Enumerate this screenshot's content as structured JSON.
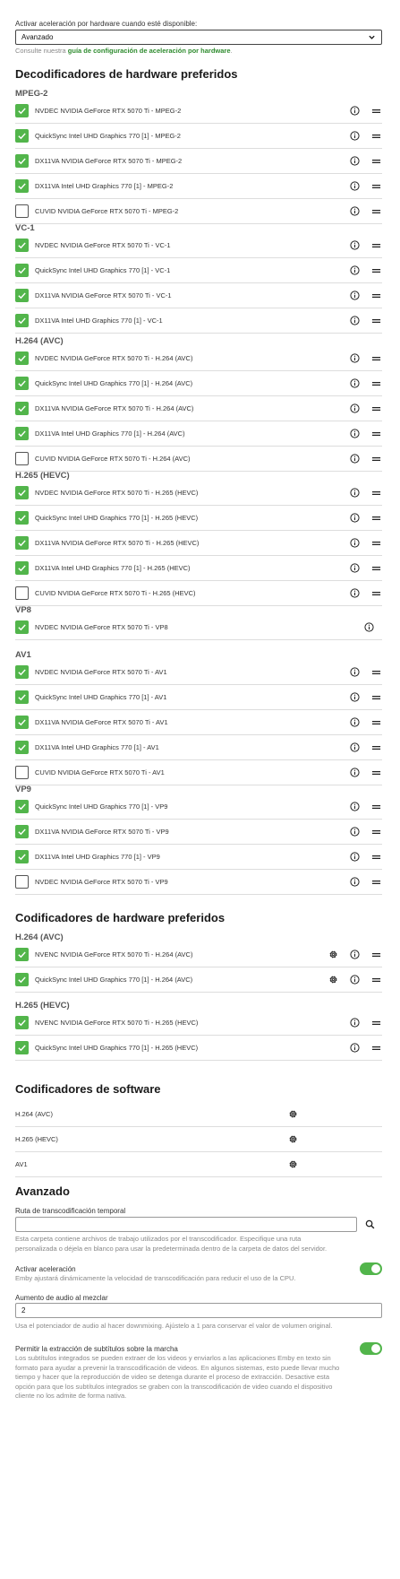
{
  "hw_accel": {
    "label": "Activar aceleración por hardware cuando esté disponible:",
    "value": "Avanzado",
    "help_prefix": "Consulte nuestra ",
    "help_link": "guía de configuración de aceleración por hardware",
    "help_suffix": "."
  },
  "decoders": {
    "title": "Decodificadores de hardware preferidos",
    "groups": [
      {
        "name": "MPEG-2",
        "items": [
          {
            "label": "NVDEC NVIDIA GeForce RTX 5070 Ti - MPEG-2",
            "checked": true
          },
          {
            "label": "QuickSync Intel UHD Graphics 770 [1] - MPEG-2",
            "checked": true
          },
          {
            "label": "DX11VA NVIDIA GeForce RTX 5070 Ti - MPEG-2",
            "checked": true
          },
          {
            "label": "DX11VA Intel UHD Graphics 770 [1] - MPEG-2",
            "checked": true
          },
          {
            "label": "CUVID NVIDIA GeForce RTX 5070 Ti - MPEG-2",
            "checked": false
          }
        ]
      },
      {
        "name": "VC-1",
        "items": [
          {
            "label": "NVDEC NVIDIA GeForce RTX 5070 Ti - VC-1",
            "checked": true
          },
          {
            "label": "QuickSync Intel UHD Graphics 770 [1] - VC-1",
            "checked": true
          },
          {
            "label": "DX11VA NVIDIA GeForce RTX 5070 Ti - VC-1",
            "checked": true
          },
          {
            "label": "DX11VA Intel UHD Graphics 770 [1] - VC-1",
            "checked": true
          }
        ]
      },
      {
        "name": "H.264 (AVC)",
        "items": [
          {
            "label": "NVDEC NVIDIA GeForce RTX 5070 Ti - H.264 (AVC)",
            "checked": true
          },
          {
            "label": "QuickSync Intel UHD Graphics 770 [1] - H.264 (AVC)",
            "checked": true
          },
          {
            "label": "DX11VA NVIDIA GeForce RTX 5070 Ti - H.264 (AVC)",
            "checked": true
          },
          {
            "label": "DX11VA Intel UHD Graphics 770 [1] - H.264 (AVC)",
            "checked": true
          },
          {
            "label": "CUVID NVIDIA GeForce RTX 5070 Ti - H.264 (AVC)",
            "checked": false
          }
        ]
      },
      {
        "name": "H.265 (HEVC)",
        "items": [
          {
            "label": "NVDEC NVIDIA GeForce RTX 5070 Ti - H.265 (HEVC)",
            "checked": true
          },
          {
            "label": "QuickSync Intel UHD Graphics 770 [1] - H.265 (HEVC)",
            "checked": true
          },
          {
            "label": "DX11VA NVIDIA GeForce RTX 5070 Ti - H.265 (HEVC)",
            "checked": true
          },
          {
            "label": "DX11VA Intel UHD Graphics 770 [1] - H.265 (HEVC)",
            "checked": true
          },
          {
            "label": "CUVID NVIDIA GeForce RTX 5070 Ti - H.265 (HEVC)",
            "checked": false
          }
        ]
      },
      {
        "name": "VP8",
        "single": true,
        "items": [
          {
            "label": "NVDEC NVIDIA GeForce RTX 5070 Ti - VP8",
            "checked": true
          }
        ]
      },
      {
        "name": "AV1",
        "items": [
          {
            "label": "NVDEC NVIDIA GeForce RTX 5070 Ti - AV1",
            "checked": true
          },
          {
            "label": "QuickSync Intel UHD Graphics 770 [1] - AV1",
            "checked": true
          },
          {
            "label": "DX11VA NVIDIA GeForce RTX 5070 Ti - AV1",
            "checked": true
          },
          {
            "label": "DX11VA Intel UHD Graphics 770 [1] - AV1",
            "checked": true
          },
          {
            "label": "CUVID NVIDIA GeForce RTX 5070 Ti - AV1",
            "checked": false
          }
        ]
      },
      {
        "name": "VP9",
        "items": [
          {
            "label": "QuickSync Intel UHD Graphics 770 [1] - VP9",
            "checked": true
          },
          {
            "label": "DX11VA NVIDIA GeForce RTX 5070 Ti - VP9",
            "checked": true
          },
          {
            "label": "DX11VA Intel UHD Graphics 770 [1] - VP9",
            "checked": true
          },
          {
            "label": "NVDEC NVIDIA GeForce RTX 5070 Ti - VP9",
            "checked": false
          }
        ]
      }
    ]
  },
  "encoders": {
    "title": "Codificadores de hardware preferidos",
    "groups": [
      {
        "name": "H.264 (AVC)",
        "items": [
          {
            "label": "NVENC NVIDIA GeForce RTX 5070 Ti - H.264 (AVC)",
            "checked": true,
            "gear": true
          },
          {
            "label": "QuickSync Intel UHD Graphics 770 [1] - H.264 (AVC)",
            "checked": true,
            "gear": true
          }
        ]
      },
      {
        "name": "H.265 (HEVC)",
        "items": [
          {
            "label": "NVENC NVIDIA GeForce RTX 5070 Ti - H.265 (HEVC)",
            "checked": true
          },
          {
            "label": "QuickSync Intel UHD Graphics 770 [1] - H.265 (HEVC)",
            "checked": true
          }
        ]
      }
    ]
  },
  "software": {
    "title": "Codificadores de software",
    "items": [
      "H.264 (AVC)",
      "H.265 (HEVC)",
      "AV1"
    ]
  },
  "advanced": {
    "title": "Avanzado",
    "temp_path_label": "Ruta de transcodificación temporal",
    "temp_path_value": "",
    "temp_path_help": "Esta carpeta contiene archivos de trabajo utilizados por el transcodificador. Especifique una ruta personalizada o déjela en blanco para usar la predeterminada dentro de la carpeta de datos del servidor.",
    "throttle_label": "Activar aceleración",
    "throttle_help": "Emby ajustará dinámicamente la velocidad de transcodificación para reducir el uso de la CPU.",
    "throttle_on": true,
    "boost_label": "Aumento de audio al mezclar",
    "boost_value": "2",
    "boost_help": "Usa el potenciador de audio al hacer downmixing. Ajústelo a 1 para conservar el valor de volumen original.",
    "subs_label": "Permitir la extracción de subtítulos sobre la marcha",
    "subs_help": "Los subtítulos integrados se pueden extraer de los videos y enviarlos a las aplicaciones Emby en texto sin formato para ayudar a prevenir la transcodificación de videos. En algunos sistemas, esto puede llevar mucho tiempo y hacer que la reproducción de video se detenga durante el proceso de extracción. Desactive esta opción para que los subtítulos integrados se graben con la transcodificación de video cuando el dispositivo cliente no los admite de forma nativa.",
    "subs_on": true
  },
  "icons": {
    "info": "info-icon",
    "drag": "drag-handle-icon",
    "gear": "gear-icon",
    "search": "search-icon",
    "chevron": "chevron-down-icon"
  },
  "colors": {
    "accent": "#52b54b",
    "link": "#2e8b2e"
  }
}
